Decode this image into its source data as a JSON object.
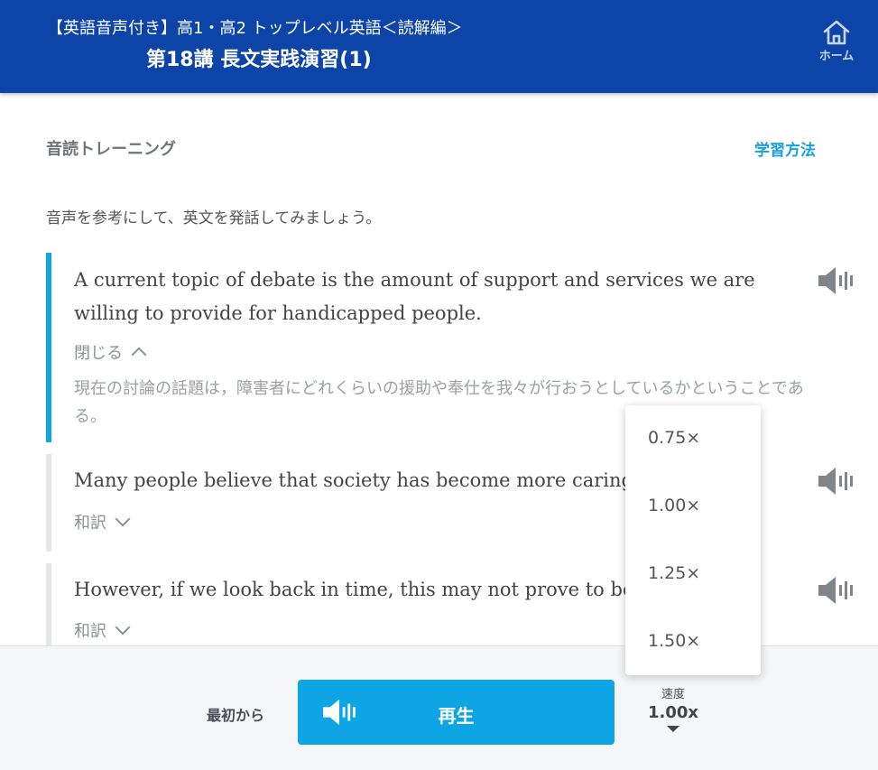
{
  "header": {
    "course_title": "【英語音声付き】高1・高2 トップレベル英語＜読解編＞",
    "lesson_title": "第18講 長文実践演習(1)",
    "home_label": "ホーム"
  },
  "section": {
    "title": "音読トレーニング",
    "method_link": "学習方法",
    "instruction": "音声を参考にして、英文を発話してみましょう。"
  },
  "sentences": [
    {
      "text": "A current topic of debate is the amount of support and services we are willing to provide for handicapped people.",
      "toggle_label": "閉じる",
      "translation": "現在の討論の話題は，障害者にどれくらいの援助や奉仕を我々が行おうとしているかということである。",
      "expanded": true
    },
    {
      "text": "Many people believe that society has become more caring",
      "toggle_label": "和訳",
      "expanded": false
    },
    {
      "text": "However, if we look back in time, this may not prove to be",
      "toggle_label": "和訳",
      "expanded": false
    }
  ],
  "footer": {
    "from_start_label": "最初から",
    "play_label": "再生",
    "speed_label": "速度",
    "speed_value": "1.00x"
  },
  "speed_menu": {
    "options": [
      "0.75×",
      "1.00×",
      "1.25×",
      "1.50×"
    ]
  },
  "colors": {
    "header_bg": "#0d44a8",
    "accent": "#0ea5e4",
    "link": "#1aa0dc"
  },
  "icons": {
    "home": "home-icon",
    "speaker": "speaker-icon",
    "chevron_up": "chevron-up-icon",
    "chevron_down": "chevron-down-icon",
    "caret_down": "caret-down-icon"
  }
}
